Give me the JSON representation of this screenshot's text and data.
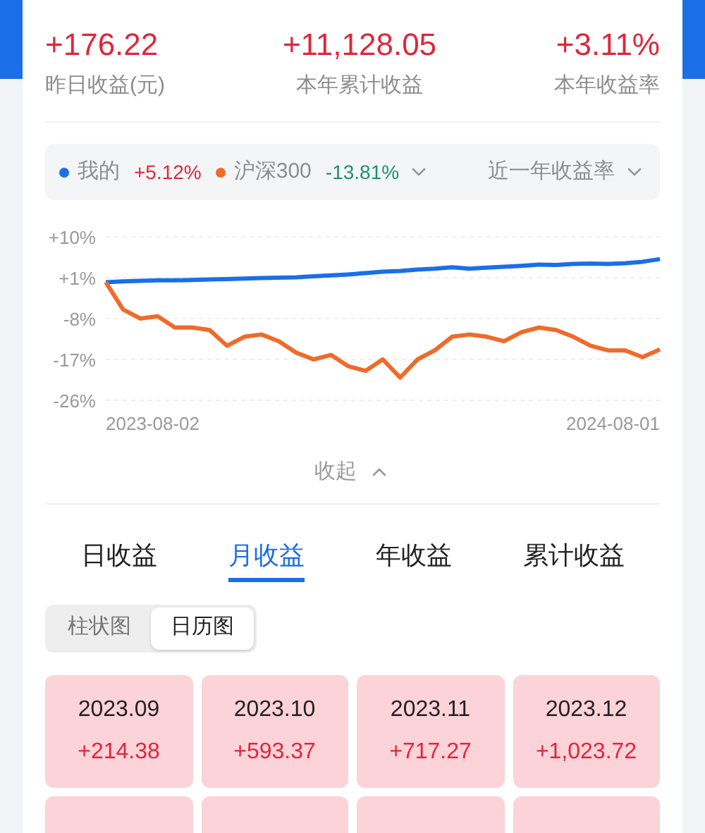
{
  "stats": [
    {
      "value": "+176.22",
      "label": "昨日收益(元)"
    },
    {
      "value": "+11,128.05",
      "label": "本年累计收益"
    },
    {
      "value": "+3.11%",
      "label": "本年收益率"
    }
  ],
  "legend": {
    "items": [
      {
        "name": "我的",
        "value": "+5.12%",
        "color": "#1a6fe8",
        "kind": "gain"
      },
      {
        "name": "沪深300",
        "value": "-13.81%",
        "color": "#f06a2a",
        "kind": "loss"
      }
    ],
    "period": "近一年收益率"
  },
  "chart_data": {
    "type": "line",
    "yticks": [
      {
        "value": 10,
        "label": "+10%"
      },
      {
        "value": 1,
        "label": "+1%"
      },
      {
        "value": -8,
        "label": "-8%"
      },
      {
        "value": -17,
        "label": "-17%"
      },
      {
        "value": -26,
        "label": "-26%"
      }
    ],
    "ylim": [
      -26,
      10
    ],
    "grid": true,
    "series": [
      {
        "color": "#1a6fe8",
        "values": [
          0,
          0.2,
          0.3,
          0.4,
          0.4,
          0.5,
          0.6,
          0.7,
          0.8,
          0.9,
          1.0,
          1.1,
          1.3,
          1.5,
          1.7,
          2.0,
          2.3,
          2.5,
          2.8,
          3.0,
          3.3,
          3.0,
          3.2,
          3.4,
          3.6,
          3.9,
          3.8,
          4.0,
          4.1,
          4.0,
          4.2,
          4.5,
          5.1
        ]
      },
      {
        "color": "#f06a2a",
        "values": [
          0,
          -6,
          -8,
          -7.5,
          -10,
          -10,
          -10.5,
          -14,
          -12,
          -11.5,
          -13,
          -15.5,
          -17,
          -16,
          -18.5,
          -19.5,
          -17,
          -21,
          -17,
          -15,
          -12,
          -11.5,
          -12,
          -13,
          -11,
          -10,
          -10.5,
          -12,
          -14,
          -15,
          -15,
          -16.5,
          -14.8
        ]
      }
    ]
  },
  "chart_dates": [
    "2023-08-02",
    "2024-08-01"
  ],
  "collapse": "收起",
  "tabs": [
    {
      "label": "日收益",
      "selected": false
    },
    {
      "label": "月收益",
      "selected": true
    },
    {
      "label": "年收益",
      "selected": false
    },
    {
      "label": "累计收益",
      "selected": false
    }
  ],
  "view_toggle": [
    {
      "label": "柱状图",
      "selected": false
    },
    {
      "label": "日历图",
      "selected": true
    }
  ],
  "months": [
    {
      "kind": "full",
      "month": "2023.09",
      "value": "+214.38"
    },
    {
      "kind": "full",
      "month": "2023.10",
      "value": "+593.37"
    },
    {
      "kind": "full",
      "month": "2023.11",
      "value": "+717.27"
    },
    {
      "kind": "full",
      "month": "2023.12",
      "value": "+1,023.72"
    },
    {
      "kind": "cut"
    },
    {
      "kind": "cut"
    },
    {
      "kind": "cut"
    },
    {
      "kind": "cut"
    }
  ]
}
